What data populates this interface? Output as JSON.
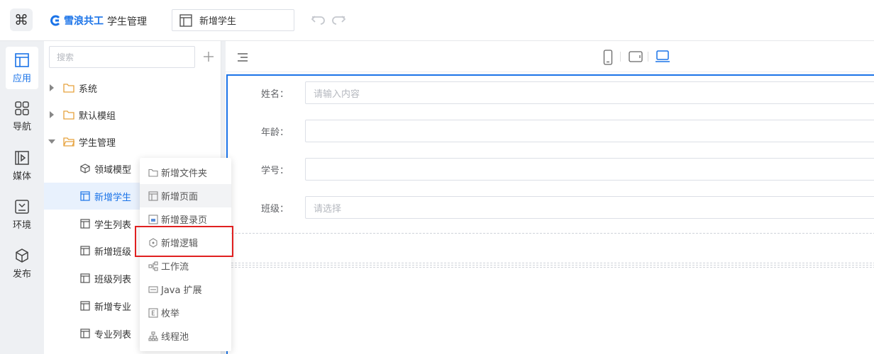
{
  "header": {
    "brand_name": "雪浪共工",
    "app_name": "学生管理",
    "page_tab": "新增学生",
    "brand_color": "#1a73e8"
  },
  "rail": {
    "items": [
      {
        "label": "应用",
        "icon": "app-layout-icon",
        "active": true
      },
      {
        "label": "导航",
        "icon": "grid-icon"
      },
      {
        "label": "媒体",
        "icon": "media-icon"
      },
      {
        "label": "环境",
        "icon": "environment-icon"
      },
      {
        "label": "发布",
        "icon": "publish-cube-icon"
      }
    ]
  },
  "tree": {
    "search_placeholder": "搜索",
    "items": [
      {
        "label": "系统",
        "type": "folder",
        "expanded": false
      },
      {
        "label": "默认模组",
        "type": "folder",
        "expanded": false
      },
      {
        "label": "学生管理",
        "type": "folder",
        "expanded": true
      },
      {
        "label": "领域模型",
        "type": "model"
      },
      {
        "label": "新增学生",
        "type": "page",
        "selected": true
      },
      {
        "label": "学生列表",
        "type": "page"
      },
      {
        "label": "新增班级",
        "type": "page"
      },
      {
        "label": "班级列表",
        "type": "page"
      },
      {
        "label": "新增专业",
        "type": "page"
      },
      {
        "label": "专业列表",
        "type": "page"
      }
    ]
  },
  "context_menu": {
    "items": [
      {
        "label": "新增文件夹",
        "icon": "folder-icon"
      },
      {
        "label": "新增页面",
        "icon": "page-icon",
        "hover": true
      },
      {
        "label": "新增登录页",
        "icon": "login-page-icon"
      },
      {
        "label": "新增逻辑",
        "icon": "logic-icon",
        "highlighted": true
      },
      {
        "label": "工作流",
        "icon": "workflow-icon"
      },
      {
        "label": "Java 扩展",
        "icon": "java-icon"
      },
      {
        "label": "枚举",
        "icon": "enum-icon"
      },
      {
        "label": "线程池",
        "icon": "thread-pool-icon"
      }
    ]
  },
  "form": {
    "fields": [
      {
        "label": "姓名：",
        "placeholder": "请输入内容"
      },
      {
        "label": "年龄：",
        "placeholder": ""
      },
      {
        "label": "学号：",
        "placeholder": ""
      },
      {
        "label": "班级：",
        "placeholder": "请选择"
      }
    ]
  }
}
